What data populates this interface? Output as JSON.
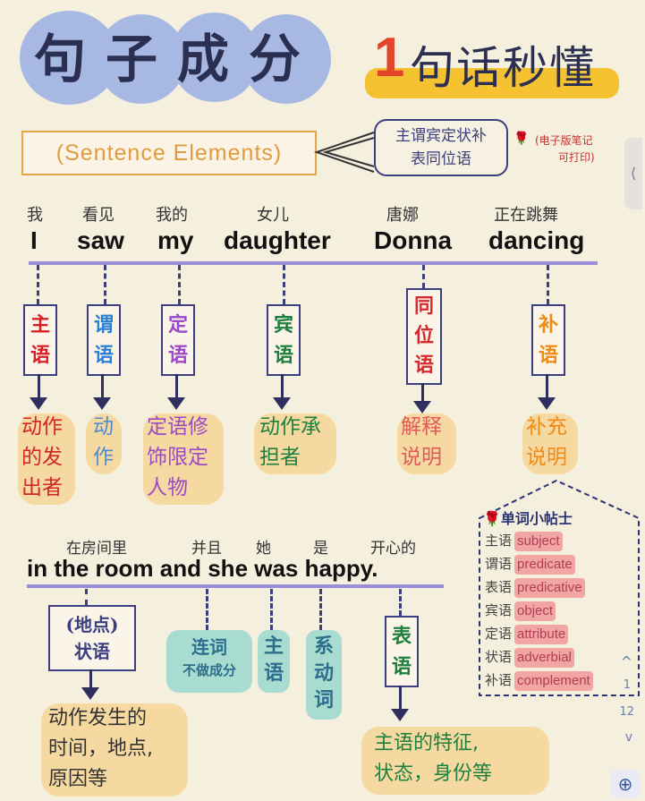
{
  "title": {
    "main": "句子成分",
    "number": "1",
    "subtitle": "句话秒懂"
  },
  "english_label": "(Sentence Elements)",
  "categories": {
    "line1": "主谓宾定状补",
    "line2": "表同位语"
  },
  "note": {
    "marker": "🌹",
    "line1": "(电子版笔记",
    "line2": "可打印)"
  },
  "sentence1": {
    "words": [
      {
        "en": "I",
        "zh": "我"
      },
      {
        "en": "saw",
        "zh": "看见"
      },
      {
        "en": "my",
        "zh": "我的"
      },
      {
        "en": "daughter",
        "zh": "女儿"
      },
      {
        "en": "Donna",
        "zh": "唐娜"
      },
      {
        "en": "dancing",
        "zh": "正在跳舞"
      }
    ],
    "roles": [
      {
        "l1": "主",
        "l2": "语",
        "color": "#d81f26"
      },
      {
        "l1": "谓",
        "l2": "语",
        "color": "#2d7fd3"
      },
      {
        "l1": "定",
        "l2": "语",
        "color": "#9b48c9"
      },
      {
        "l1": "宾",
        "l2": "语",
        "color": "#1d7f3d"
      },
      {
        "l1": "同",
        "l2": "位",
        "l3": "语",
        "color": "#d8292e"
      },
      {
        "l1": "补",
        "l2": "语",
        "color": "#ef8a17"
      }
    ],
    "descs": [
      {
        "l1": "动作",
        "l2": "的发",
        "l3": "出者",
        "color": "#d1252a"
      },
      {
        "l1": "动",
        "l2": "作",
        "color": "#4f8ccf"
      },
      {
        "l1": "定语修",
        "l2": "饰限定",
        "l3": "人物",
        "color": "#9b4bc4"
      },
      {
        "l1": "动作承",
        "l2": "担者",
        "color": "#1e8040"
      },
      {
        "l1": "解释",
        "l2": "说明",
        "color": "#e05a5a"
      },
      {
        "l1": "补充",
        "l2": "说明",
        "color": "#ef8a17"
      }
    ]
  },
  "sentence2": {
    "text": "in the room and she was happy.",
    "glosses": [
      "在房间里",
      "并且",
      "她",
      "是",
      "开心的"
    ],
    "roles": {
      "adverbial": {
        "l1": "(地点)",
        "l2": "状语",
        "desc1": "动作发生的",
        "desc2": "时间，地点,",
        "desc3": "原因等"
      },
      "conj": {
        "l1": "连词",
        "l2": "不做成分"
      },
      "subject": {
        "l1": "主",
        "l2": "语"
      },
      "linking": {
        "l1": "系",
        "l2": "动",
        "l3": "词"
      },
      "predicative": {
        "l1": "表",
        "l2": "语",
        "desc1": "主语的特征,",
        "desc2": "状态，身份等"
      }
    }
  },
  "tips": {
    "heading": "🌹单词小帖士",
    "items": [
      {
        "zh": "主语",
        "en": "subject"
      },
      {
        "zh": "谓语",
        "en": "predicate"
      },
      {
        "zh": "表语",
        "en": "predicative"
      },
      {
        "zh": "宾语",
        "en": "object"
      },
      {
        "zh": "定语",
        "en": "attribute"
      },
      {
        "zh": "状语",
        "en": "adverbial"
      },
      {
        "zh": "补语",
        "en": "complement"
      }
    ]
  },
  "viewer": {
    "page_current": "1",
    "page_total": "12",
    "up": "^",
    "down": "v",
    "zoom": "⊕",
    "side_tab": "⟨"
  },
  "colors": {
    "bg": "#f5efde",
    "blob": "#a7b8e3",
    "highlight": "#f5c232",
    "line": "#9a8ed9",
    "tag_pink": "#f1a6a4"
  }
}
